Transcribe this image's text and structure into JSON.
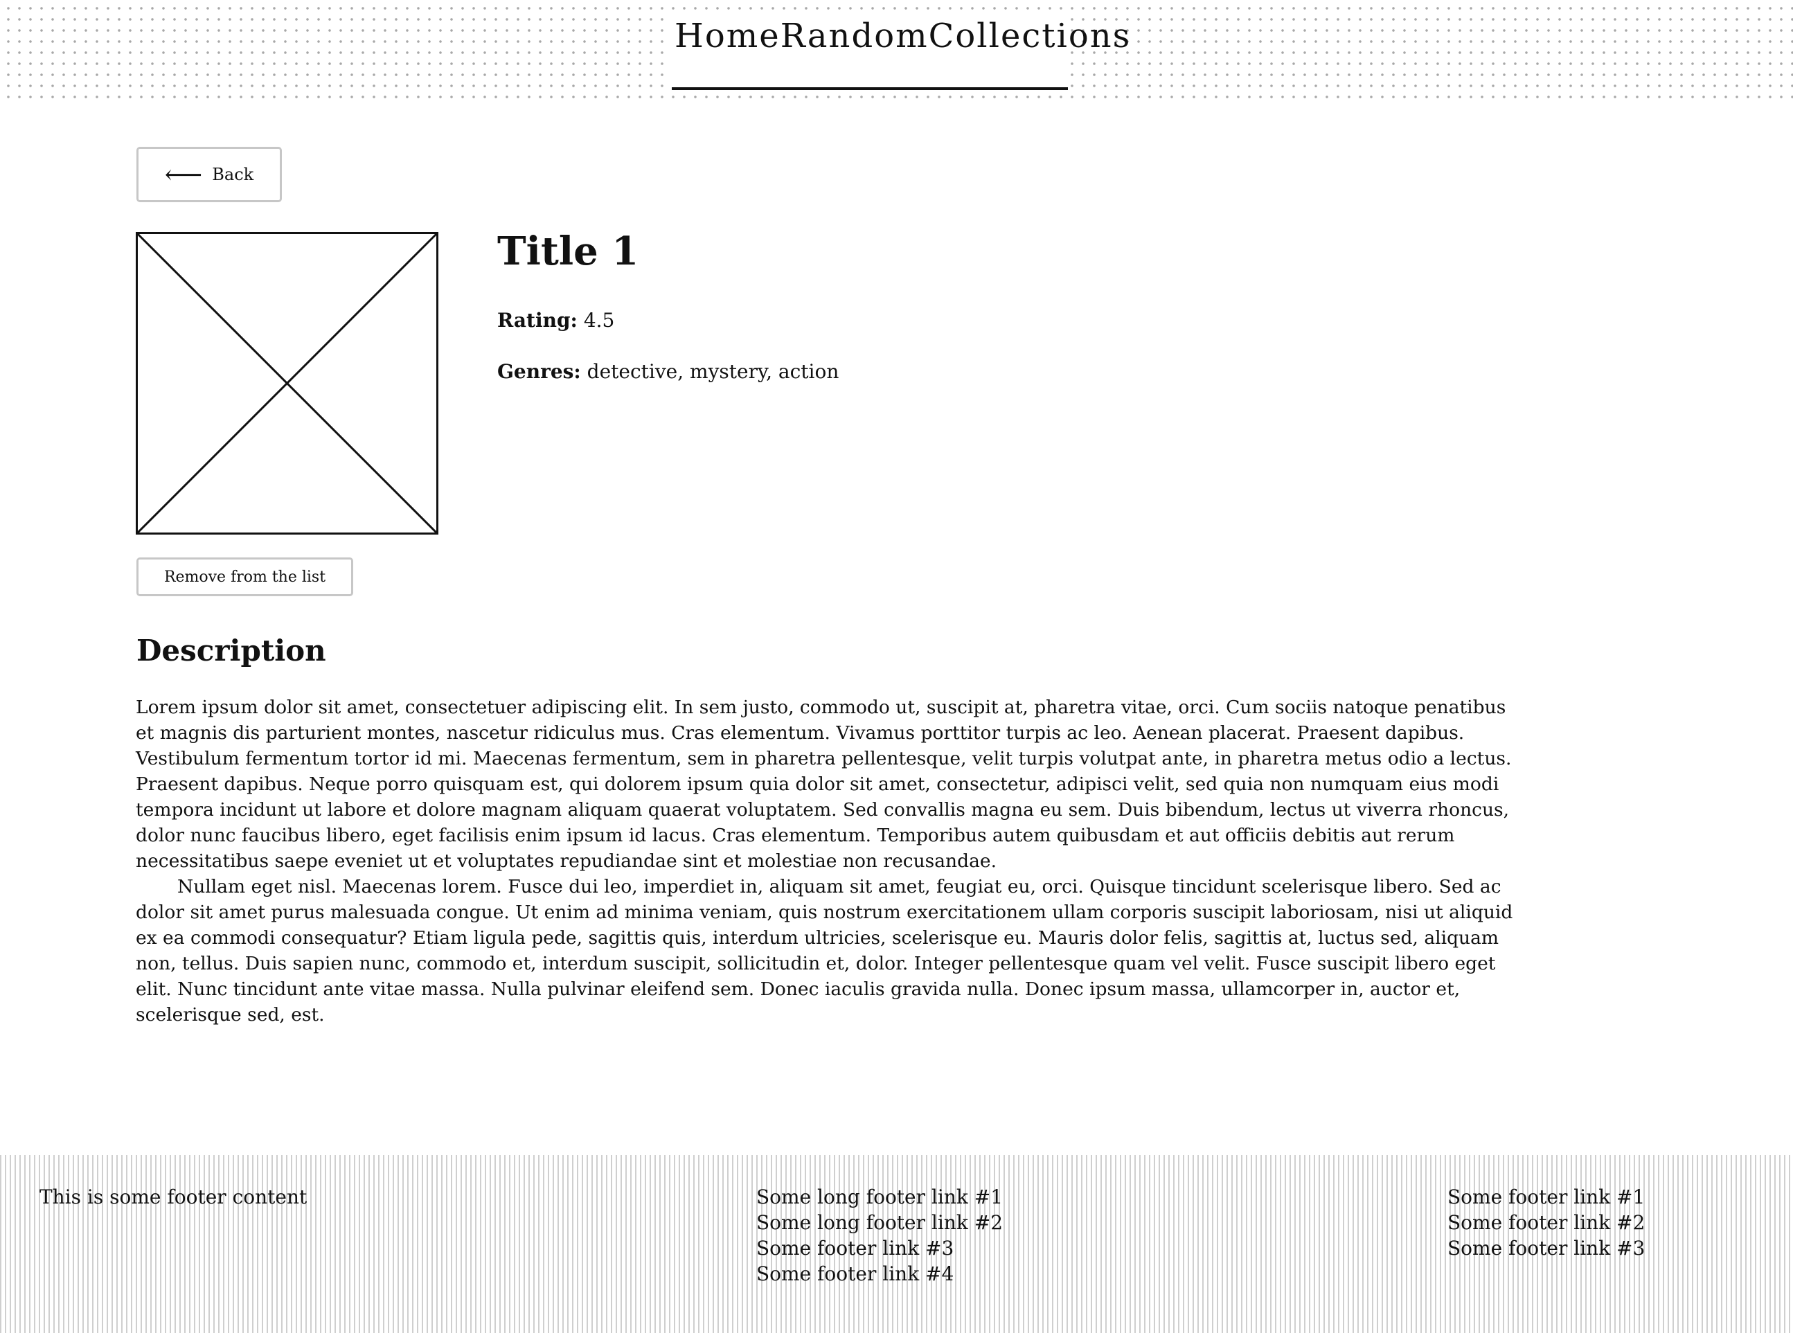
{
  "nav": {
    "items": [
      {
        "label": "Home"
      },
      {
        "label": "Random"
      },
      {
        "label": "Collections"
      }
    ]
  },
  "back_button": {
    "label": "Back",
    "icon": "arrow-left-icon"
  },
  "item": {
    "image_icon": "image-placeholder-icon",
    "title": "Title 1",
    "rating_label": "Rating:",
    "rating_value": "4.5",
    "genres_label": "Genres:",
    "genres_value": "detective, mystery, action",
    "remove_label": "Remove from the list"
  },
  "description": {
    "heading": "Description",
    "paragraphs": [
      "Lorem ipsum dolor sit amet, consectetuer adipiscing elit. In sem justo, commodo ut, suscipit at, pharetra vitae, orci. Cum sociis natoque penatibus et magnis dis parturient montes, nascetur ridiculus mus. Cras elementum. Vivamus porttitor turpis ac leo. Aenean placerat. Praesent dapibus. Vestibulum fermentum tortor id mi. Maecenas fermentum, sem in pharetra pellentesque, velit turpis volutpat ante, in pharetra metus odio a lectus. Praesent dapibus. Neque porro quisquam est, qui dolorem ipsum quia dolor sit amet, consectetur, adipisci velit, sed quia non numquam eius modi tempora incidunt ut labore et dolore magnam aliquam quaerat voluptatem. Sed convallis magna eu sem. Duis bibendum, lectus ut viverra rhoncus, dolor nunc faucibus libero, eget facilisis enim ipsum id lacus. Cras elementum. Temporibus autem quibusdam et aut officiis debitis aut rerum necessitatibus saepe eveniet ut et voluptates repudiandae sint et molestiae non recusandae.",
      "Nullam eget nisl. Maecenas lorem. Fusce dui leo, imperdiet in, aliquam sit amet, feugiat eu, orci. Quisque tincidunt scelerisque libero. Sed ac dolor sit amet purus malesuada congue. Ut enim ad minima veniam, quis nostrum exercitationem ullam corporis suscipit laboriosam, nisi ut aliquid ex ea commodi consequatur? Etiam ligula pede, sagittis quis, interdum ultricies, scelerisque eu. Mauris dolor felis, sagittis at, luctus sed, aliquam non, tellus. Duis sapien nunc, commodo et, interdum suscipit, sollicitudin et, dolor. Integer pellentesque quam vel velit. Fusce suscipit libero eget elit. Nunc tincidunt ante vitae massa. Nulla pulvinar eleifend sem. Donec iaculis gravida nulla. Donec ipsum massa, ullamcorper in, auctor et, scelerisque sed, est."
    ]
  },
  "footer": {
    "content": "This is some footer content",
    "middle_links": [
      "Some long footer link #1",
      "Some long footer link #2",
      "Some footer link #3",
      "Some footer link #4"
    ],
    "right_links": [
      "Some footer link #1",
      "Some footer link #2",
      "Some footer link #3"
    ]
  }
}
